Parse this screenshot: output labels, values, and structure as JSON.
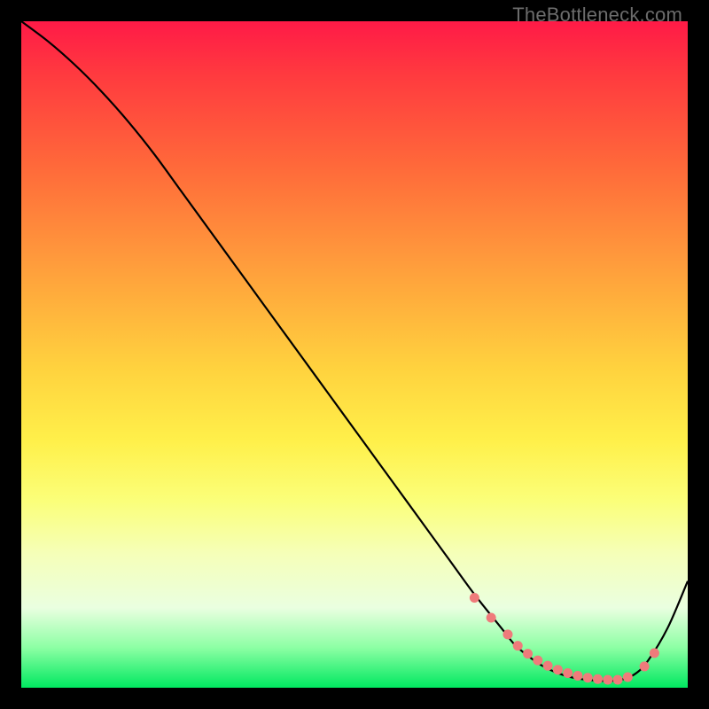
{
  "watermark": "TheBottleneck.com",
  "chart_data": {
    "type": "line",
    "title": "",
    "xlabel": "",
    "ylabel": "",
    "xlim": [
      0,
      100
    ],
    "ylim": [
      0,
      100
    ],
    "series": [
      {
        "name": "curve",
        "x": [
          0,
          4,
          8,
          12,
          16,
          20,
          24,
          28,
          32,
          36,
          40,
          44,
          48,
          52,
          56,
          60,
          64,
          68,
          72,
          74,
          76,
          78,
          80,
          82,
          84,
          86,
          88,
          90,
          92,
          94,
          97,
          100
        ],
        "y": [
          100,
          97,
          93.5,
          89.5,
          85,
          80,
          74.5,
          69,
          63.5,
          58,
          52.5,
          47,
          41.5,
          36,
          30.5,
          25,
          19.5,
          14,
          9,
          6.5,
          4.8,
          3.4,
          2.4,
          1.7,
          1.3,
          1.1,
          1.0,
          1.2,
          2.0,
          4.0,
          9.0,
          16.0
        ]
      }
    ],
    "markers": {
      "name": "dots",
      "color": "#ef7b7b",
      "x": [
        68,
        70.5,
        73,
        74.5,
        76,
        77.5,
        79,
        80.5,
        82,
        83.5,
        85,
        86.5,
        88,
        89.5,
        91,
        93.5,
        95
      ],
      "y": [
        13.5,
        10.5,
        8,
        6.3,
        5.1,
        4.1,
        3.3,
        2.7,
        2.2,
        1.8,
        1.5,
        1.3,
        1.2,
        1.2,
        1.6,
        3.2,
        5.2
      ]
    }
  }
}
